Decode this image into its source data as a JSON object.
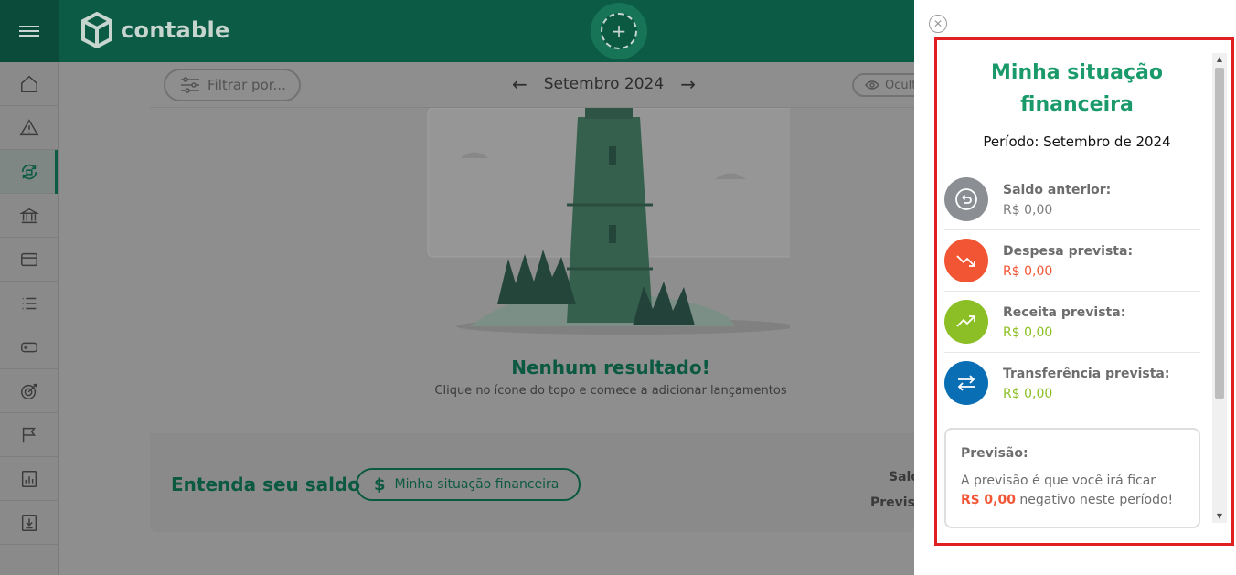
{
  "header": {
    "logo_text": "contable",
    "add_icon": "plus-circle-icon"
  },
  "toolbar": {
    "filter_label": "Filtrar por...",
    "month": "Setembro 2024",
    "hide_label": "Ocult"
  },
  "empty_state": {
    "title": "Nenhum resultado!",
    "subtitle": "Clique no ícone do topo e comece a adicionar lançamentos"
  },
  "balance": {
    "title": "Entenda seu saldo",
    "button_label": "Minha situação financeira",
    "label_saldo": "Saldo",
    "label_previsao": "Previsã"
  },
  "panel": {
    "title": "Minha situação financeira",
    "period": "Período: Setembro de 2024",
    "items": [
      {
        "label": "Saldo anterior:",
        "value": "R$ 0,00",
        "color": "#8b8f93",
        "value_color": "#7d7d7d",
        "icon": "undo-icon"
      },
      {
        "label": "Despesa prevista:",
        "value": "R$ 0,00",
        "color": "#f25533",
        "value_color": "#f25533",
        "icon": "trending-down-icon"
      },
      {
        "label": "Receita prevista:",
        "value": "R$ 0,00",
        "color": "#8cbf26",
        "value_color": "#8cbf26",
        "icon": "trending-up-icon"
      },
      {
        "label": "Transferência prevista:",
        "value": "R$ 0,00",
        "color": "#0a6eb4",
        "value_color": "#8cbf26",
        "icon": "transfer-icon"
      }
    ],
    "forecast": {
      "title": "Previsão:",
      "text_before": "A previsão é que você irá ficar",
      "amount": "R$ 0,00",
      "text_after": "negativo neste período!"
    }
  },
  "colors": {
    "brand_dark": "#0c5b44",
    "brand_accent": "#1a9a6a",
    "alert_frame": "#e02020"
  }
}
